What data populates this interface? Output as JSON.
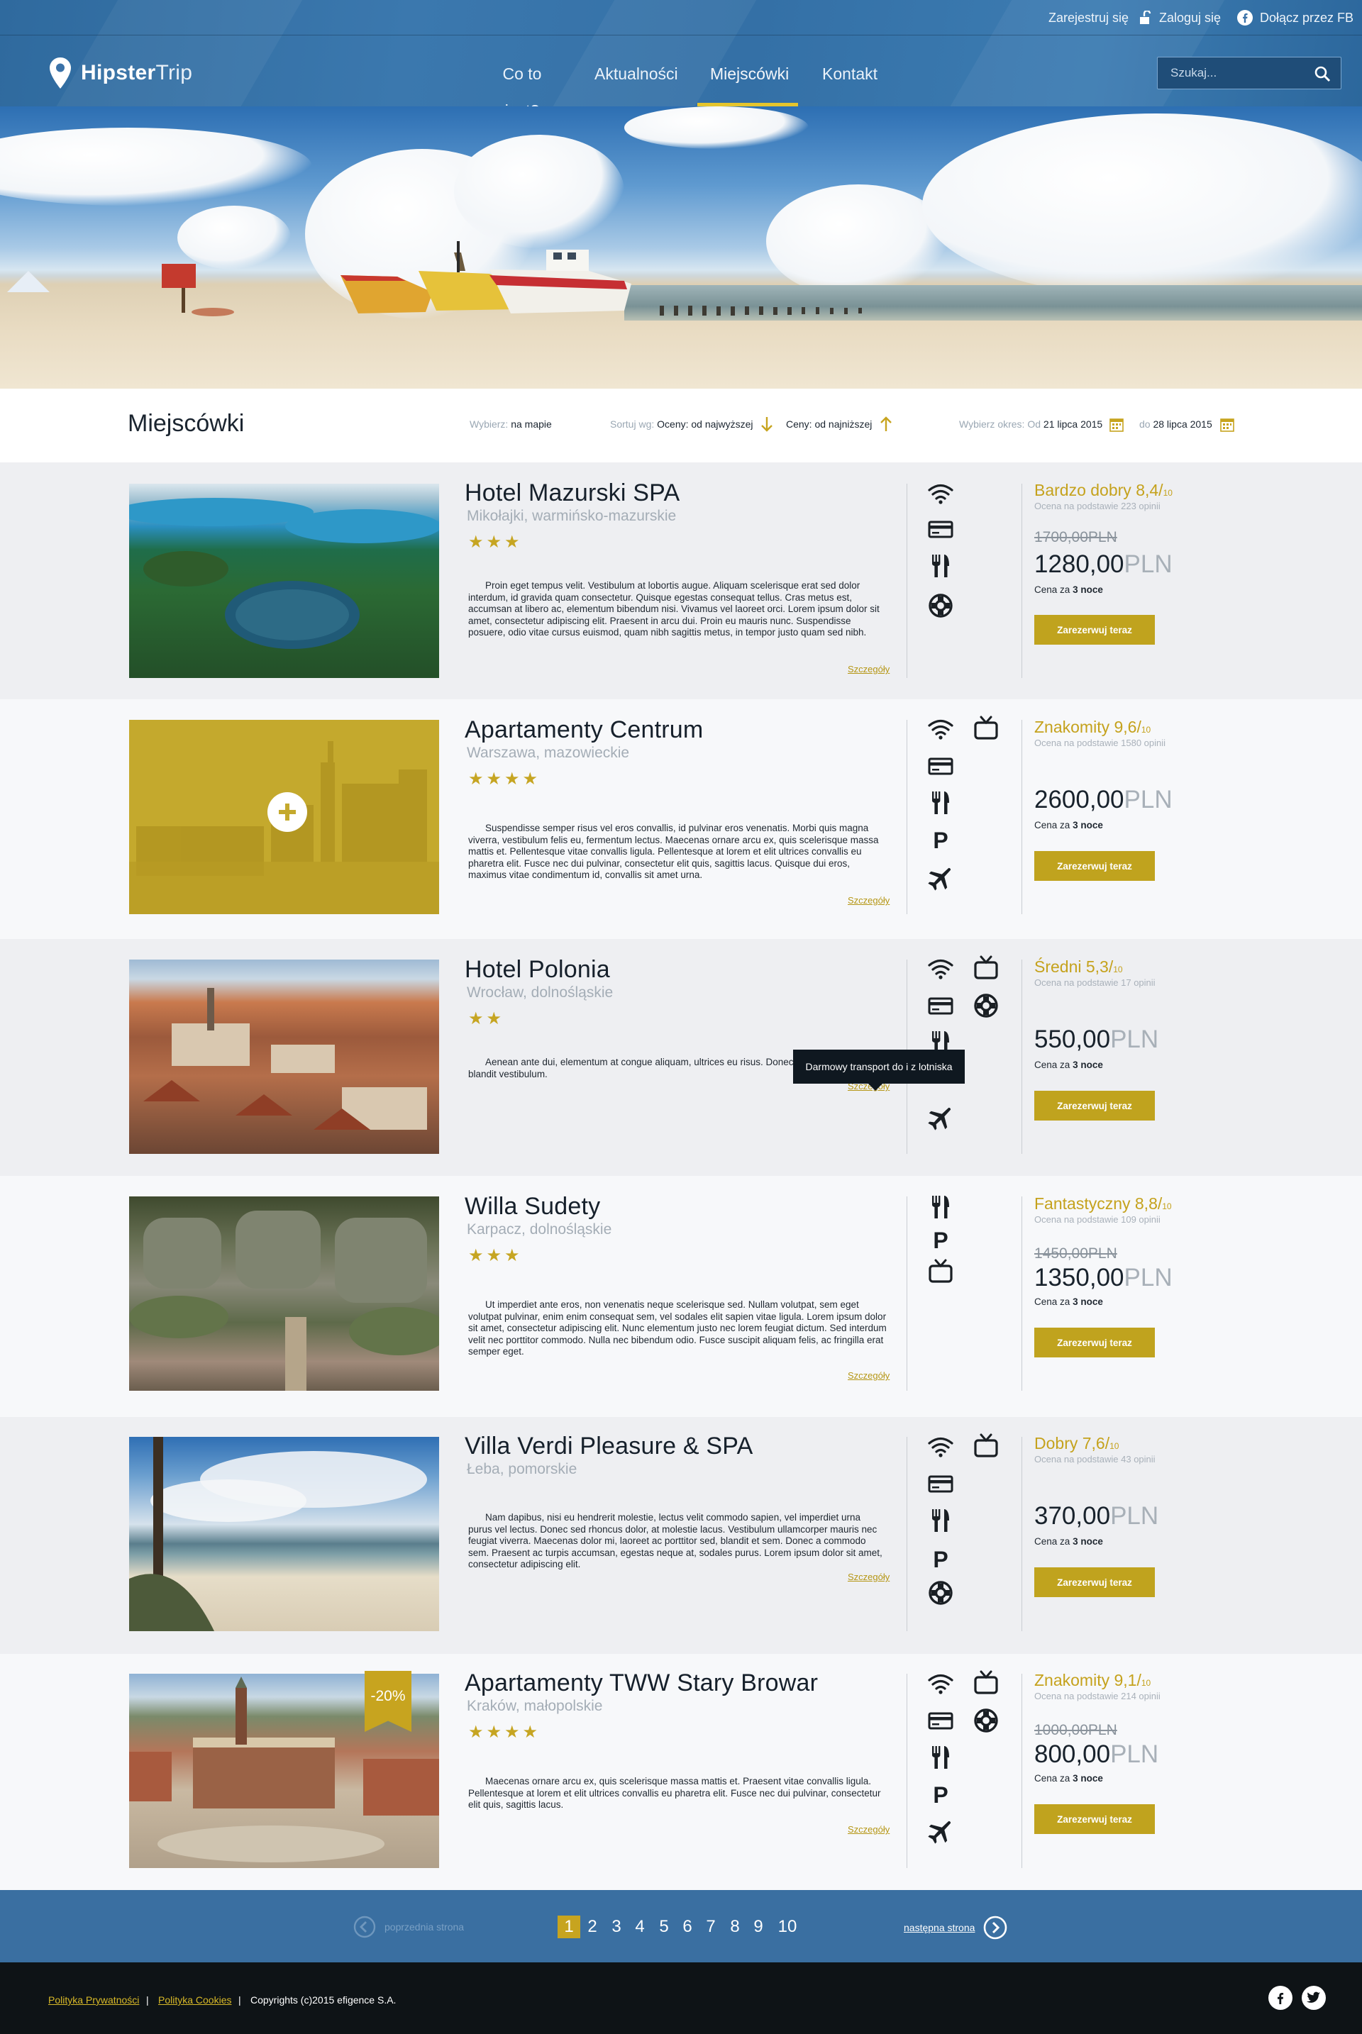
{
  "topbar": {
    "register": "Zarejestruj się",
    "login": "Zaloguj się",
    "facebook_join": "Dołącz przez FB"
  },
  "brand": {
    "name_bold": "Hipster",
    "name_light": "Trip"
  },
  "nav": [
    "Co to jest?",
    "Aktualności",
    "Miejscówki",
    "Kontakt"
  ],
  "nav_active": "Miejscówki",
  "search": {
    "placeholder": "Szukaj..."
  },
  "filters": {
    "page_title": "Miejscówki",
    "choose_label": "Wybierz:",
    "choose_value": "na mapie",
    "sort_label": "Sortuj wg:",
    "sort_ratings": "Oceny: od najwyższej",
    "sort_prices": "Ceny: od najniższej",
    "period_label": "Wybierz okres:",
    "from_label": "Od",
    "from_value": "21 lipca 2015",
    "to_label": "do",
    "to_value": "28 lipca 2015"
  },
  "listings": [
    {
      "title": "Hotel Mazurski SPA",
      "location": "Mikołajki, warmińsko-mazurskie",
      "stars": "★★★",
      "description": "Proin eget tempus velit. Vestibulum at lobortis augue. Aliquam scelerisque erat sed dolor interdum, id gravida quam consectetur. Quisque egestas consequat tellus. Cras metus est, accumsan at libero ac, elementum bibendum nisi. Vivamus vel laoreet orci. Lorem ipsum dolor sit amet, consectetur adipiscing elit. Praesent in arcu dui. Proin eu mauris nunc. Suspendisse posuere, odio vitae cursus euismod, quam nibh sagittis metus, in tempor justo quam sed nibh.",
      "details": "Szczegóły",
      "rating_label": "Bardzo dobry 8,4/",
      "rating_scale": "10",
      "reviews": "Ocena na podstawie 223 opinii",
      "old_price": "1700,00PLN",
      "price": "1280,00",
      "currency": "PLN",
      "per_prefix": "Cena za",
      "per_nights": "3 noce",
      "book": "Zarezerwuj teraz",
      "amenities": [
        "wifi-icon",
        "card-icon",
        "restaurant-icon",
        "lifebuoy-icon"
      ]
    },
    {
      "title": "Apartamenty Centrum",
      "location": "Warszawa, mazowieckie",
      "stars": "★★★★",
      "description": "Suspendisse semper risus vel eros convallis, id pulvinar eros venenatis. Morbi quis magna viverra, vestibulum felis eu, fermentum lectus. Maecenas ornare arcu ex, quis scelerisque massa mattis et. Pellentesque vitae convallis ligula. Pellentesque at lorem et elit ultrices convallis eu pharetra elit. Fusce nec dui pulvinar, consectetur elit quis, sagittis lacus. Quisque dui eros, maximus vitae condimentum id, convallis sit amet urna.",
      "details": "Szczegóły",
      "rating_label": "Znakomity 9,6/",
      "rating_scale": "10",
      "reviews": "Ocena na podstawie 1580 opinii",
      "old_price": "",
      "price": "2600,00",
      "currency": "PLN",
      "per_prefix": "Cena za",
      "per_nights": "3 noce",
      "book": "Zarezerwuj teraz",
      "amenities": [
        "wifi-icon",
        "tv-icon",
        "card-icon",
        "restaurant-icon",
        "parking-icon",
        "plane-icon"
      ]
    },
    {
      "title": "Hotel Polonia",
      "location": "Wrocław, dolnośląskie",
      "stars": "★★",
      "description": "Aenean ante dui, elementum at congue aliquam, ultrices eu risus. Donec laoreet mi ac tellus blandit vestibulum.",
      "details": "Szczegóły",
      "rating_label": "Średni 5,3/",
      "rating_scale": "10",
      "reviews": "Ocena na podstawie 17 opinii",
      "old_price": "",
      "price": "550,00",
      "currency": "PLN",
      "per_prefix": "Cena za",
      "per_nights": "3 noce",
      "book": "Zarezerwuj teraz",
      "amenities": [
        "wifi-icon",
        "tv-icon",
        "card-icon",
        "lifebuoy-icon",
        "restaurant-icon",
        "plane-icon"
      ],
      "tooltip": "Darmowy transport do i z lotniska"
    },
    {
      "title": "Willa Sudety",
      "location": "Karpacz, dolnośląskie",
      "stars": "★★★",
      "description": "Ut imperdiet ante eros, non venenatis neque scelerisque sed. Nullam volutpat, sem eget volutpat pulvinar, enim enim consequat sem, vel sodales elit sapien vitae ligula. Lorem ipsum dolor sit amet, consectetur adipiscing elit. Nunc elementum justo nec lorem feugiat dictum. Sed interdum velit nec porttitor commodo. Nulla nec bibendum odio. Fusce suscipit aliquam felis, ac fringilla erat semper eget.",
      "details": "Szczegóły",
      "rating_label": "Fantastyczny 8,8/",
      "rating_scale": "10",
      "reviews": "Ocena na podstawie 109 opinii",
      "old_price": "1450,00PLN",
      "price": "1350,00",
      "currency": "PLN",
      "per_prefix": "Cena za",
      "per_nights": "3 noce",
      "book": "Zarezerwuj teraz",
      "amenities": [
        "restaurant-icon",
        "parking-icon",
        "tv-icon"
      ]
    },
    {
      "title": "Villa Verdi Pleasure & SPA",
      "location": "Łeba, pomorskie",
      "stars": "",
      "description": "Nam dapibus, nisi eu hendrerit molestie, lectus velit commodo sapien, vel imperdiet urna purus vel lectus. Donec sed rhoncus dolor, at molestie lacus. Vestibulum ullamcorper mauris nec feugiat viverra. Maecenas dolor mi, laoreet ac porttitor sed, blandit et sem. Donec a commodo sem. Praesent ac turpis accumsan, egestas neque at, sodales purus. Lorem ipsum dolor sit amet, consectetur adipiscing elit.",
      "details": "Szczegóły",
      "rating_label": "Dobry 7,6/",
      "rating_scale": "10",
      "reviews": "Ocena na podstawie 43 opinii",
      "old_price": "",
      "price": "370,00",
      "currency": "PLN",
      "per_prefix": "Cena za",
      "per_nights": "3 noce",
      "book": "Zarezerwuj teraz",
      "amenities": [
        "wifi-icon",
        "tv-icon",
        "card-icon",
        "restaurant-icon",
        "parking-icon",
        "lifebuoy-icon"
      ]
    },
    {
      "title": "Apartamenty TWW Stary Browar",
      "location": "Kraków, małopolskie",
      "stars": "★★★★",
      "description": "Maecenas ornare arcu ex, quis scelerisque massa mattis et. Praesent vitae convallis ligula. Pellentesque at lorem et elit ultrices convallis eu pharetra elit. Fusce nec dui pulvinar, consectetur elit quis, sagittis lacus.",
      "details": "Szczegóły",
      "rating_label": "Znakomity 9,1/",
      "rating_scale": "10",
      "reviews": "Ocena na podstawie 214 opinii",
      "old_price": "1000,00PLN",
      "price": "800,00",
      "currency": "PLN",
      "per_prefix": "Cena za",
      "per_nights": "3 noce",
      "book": "Zarezerwuj teraz",
      "discount": "-20%",
      "amenities": [
        "wifi-icon",
        "tv-icon",
        "card-icon",
        "lifebuoy-icon",
        "restaurant-icon",
        "parking-icon",
        "plane-icon"
      ]
    }
  ],
  "pagination": {
    "prev": "poprzednia strona",
    "next": "następna strona",
    "pages": [
      "1",
      "2",
      "3",
      "4",
      "5",
      "6",
      "7",
      "8",
      "9",
      "10"
    ],
    "current": "1"
  },
  "footer": {
    "privacy": "Polityka Prywatności",
    "cookies": "Polityka Cookies",
    "copyright": "Copyrights (c)2015 efigence S.A.",
    "separator": "|"
  },
  "colors": {
    "accent": "#c7a41f",
    "header_blue": "#3a72a8",
    "footer_dark": "#0e1316"
  }
}
